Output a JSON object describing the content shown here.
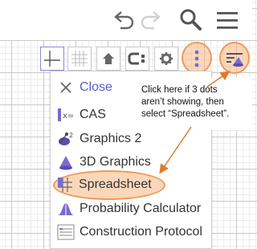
{
  "header": {
    "undo_icon": "undo-icon",
    "redo_icon": "redo-icon",
    "search_icon": "search-icon",
    "menu_icon": "hamburger-menu-icon"
  },
  "toolbar": {
    "buttons": [
      {
        "name": "axes-toggle",
        "icon": "axes-icon"
      },
      {
        "name": "grid-toggle",
        "icon": "grid-icon"
      },
      {
        "name": "standard-view",
        "icon": "home-icon"
      },
      {
        "name": "point-capturing",
        "icon": "point-capture-icon"
      },
      {
        "name": "settings",
        "icon": "gear-icon"
      },
      {
        "name": "more-options",
        "icon": "three-dots-icon"
      },
      {
        "name": "perspectives",
        "icon": "perspectives-icon"
      }
    ]
  },
  "menu": {
    "items": [
      {
        "label": "Close",
        "icon": "close-icon"
      },
      {
        "label": "CAS",
        "icon": "cas-icon"
      },
      {
        "label": "Graphics 2",
        "icon": "graphics-2-icon"
      },
      {
        "label": "3D Graphics",
        "icon": "3d-graphics-icon"
      },
      {
        "label": "Spreadsheet",
        "icon": "spreadsheet-icon"
      },
      {
        "label": "Probability Calculator",
        "icon": "probability-icon"
      },
      {
        "label": "Construction Protocol",
        "icon": "construction-protocol-icon"
      }
    ]
  },
  "callout": {
    "line1": "Click here if 3 dots",
    "line2": "aren’t showing, then",
    "line3": "select “Spreadsheet”."
  },
  "colors": {
    "highlight_fill": "#f5b682",
    "highlight_stroke": "#ee9a5a",
    "arrow": "#e07b2e",
    "close_label": "#5c5ccf",
    "icon_purple": "#7b6ad0"
  }
}
